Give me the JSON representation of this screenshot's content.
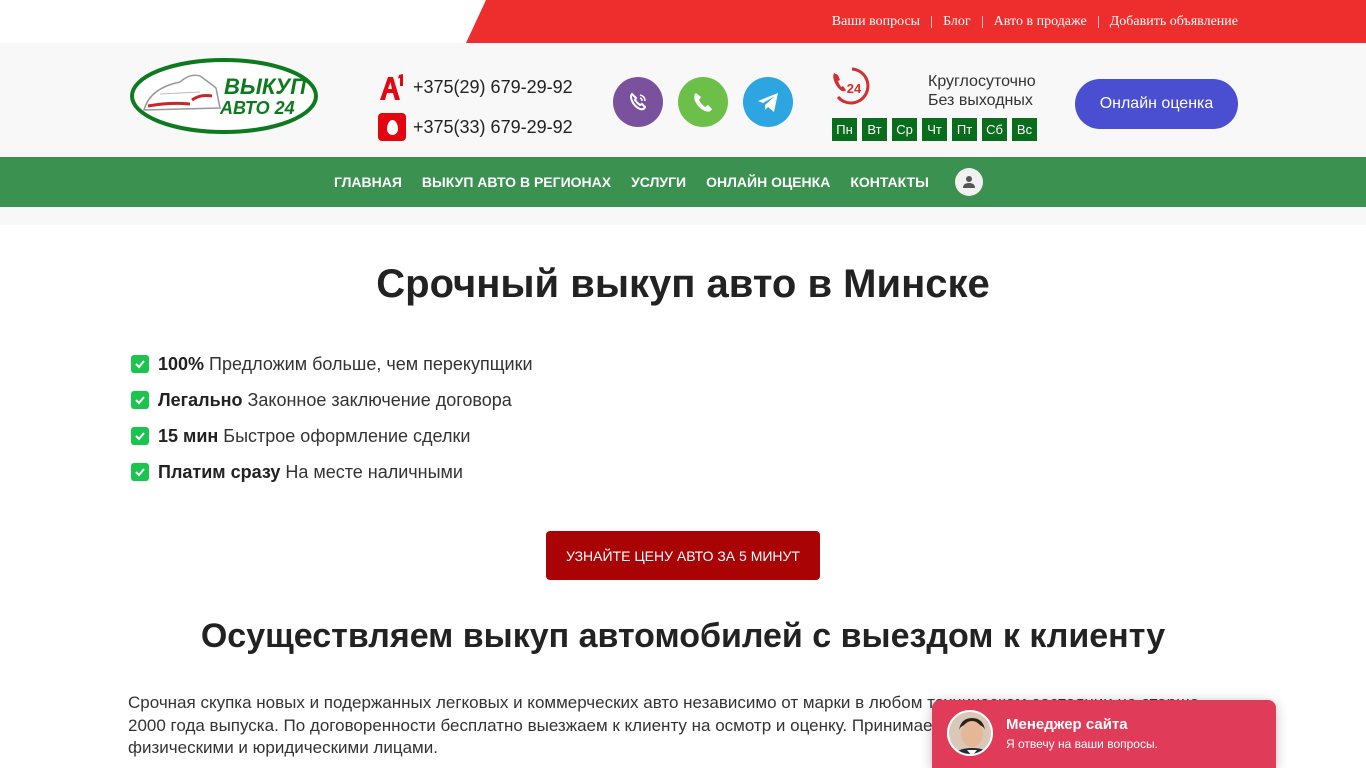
{
  "top_links": [
    "Ваши вопросы",
    "Блог",
    "Авто в продаже",
    "Добавить объявление"
  ],
  "logo": {
    "line1": "ВЫКУП",
    "line2": "АВТО 24"
  },
  "phones": [
    {
      "operator": "A1",
      "number": "+375(29) 679-29-92"
    },
    {
      "operator": "MTS",
      "number": "+375(33) 679-29-92"
    }
  ],
  "messengers": [
    "viber-icon",
    "whatsapp-icon",
    "telegram-icon"
  ],
  "schedule": {
    "badge": "24",
    "line1": "Круглосуточно",
    "line2": "Без выходных",
    "days": [
      "Пн",
      "Вт",
      "Ср",
      "Чт",
      "Пт",
      "Сб",
      "Вс"
    ]
  },
  "header_button": "Онлайн оценка",
  "nav": [
    "Главная",
    "Выкуп авто в регионах",
    "Услуги",
    "Онлайн оценка",
    "Контакты"
  ],
  "hero": {
    "title": "Срочный выкуп авто в Минске",
    "benefits": [
      {
        "bold": "100%",
        "text": "Предложим больше, чем перекупщики"
      },
      {
        "bold": "Легально",
        "text": "Законное заключение договора"
      },
      {
        "bold": "15 мин",
        "text": "Быстрое оформление сделки"
      },
      {
        "bold": "Платим сразу",
        "text": "На месте наличными"
      }
    ],
    "button": "УЗНАЙТЕ ЦЕНУ АВТО ЗА 5 МИНУТ"
  },
  "section": {
    "title": "Осуществляем выкуп автомобилей с выездом к клиенту",
    "paragraph": "Срочная скупка новых и подержанных легковых и коммерческих авто независимо от марки в любом техническом состоянии не старше 2000 года выпуска. По договоренности бесплатно выезжаем к клиенту на осмотр и оценку. Принимаем заявки круглосуточно, работаем с физическими и юридическими лицами."
  },
  "chat": {
    "title": "Менеджер сайта",
    "subtitle": "Я отвечу на ваши вопросы."
  },
  "colors": {
    "top_red": "#ee2d2d",
    "nav_green": "#3a9150",
    "day_green": "#0a6d1e",
    "cta_blue": "#4a4fd1",
    "price_red": "#a90306",
    "check_green": "#1bc34f",
    "chat_pink": "#e13b5a"
  }
}
